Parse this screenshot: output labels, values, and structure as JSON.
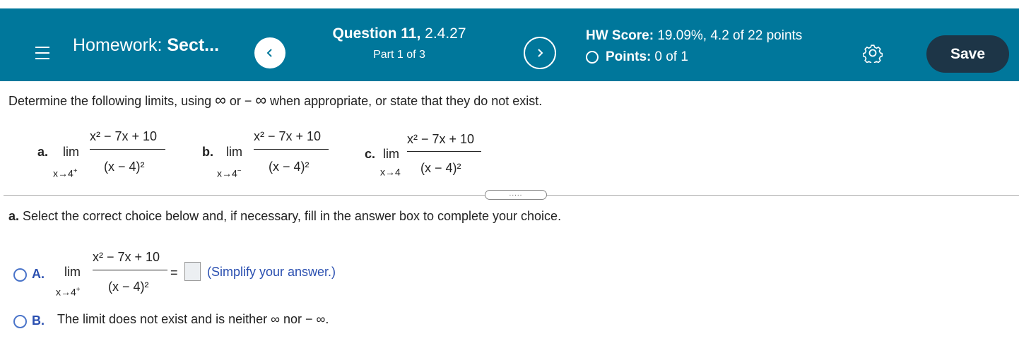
{
  "header": {
    "hw_prefix": "Homework:",
    "hw_section": "Sect...",
    "question_label": "Question 11,",
    "question_id": " 2.4.27",
    "part": "Part 1 of 3",
    "score_label": "HW Score:",
    "score_value": " 19.09%, 4.2 of 22 points",
    "points_label": "Points:",
    "points_value": "0 of 1",
    "prev_icon": "chevron-left-icon",
    "next_icon": "chevron-right-icon",
    "settings_icon": "gear-icon",
    "save_label": "Save"
  },
  "problem": {
    "instruction_pre": "Determine the following limits, using ",
    "inf_symbol": "∞",
    "instruction_mid": " or  − ",
    "instruction_post": " when appropriate, or state that they do not exist.",
    "numerator": "x² − 7x + 10",
    "denominator": "(x − 4)²",
    "lim_word": "lim",
    "parts": [
      {
        "tag": "a.",
        "approach": "x→4",
        "side": "+"
      },
      {
        "tag": "b.",
        "approach": "x→4",
        "side": "−"
      },
      {
        "tag": "c.",
        "approach": "x→4",
        "side": ""
      }
    ]
  },
  "more_label": ".....",
  "answer": {
    "prompt_tag": "a.",
    "prompt_text": " Select the correct choice below and, if necessary, fill in the answer box to complete your choice.",
    "choice_a_letter": "A.",
    "choice_a_eq": "=",
    "choice_a_hint": "(Simplify your answer.)",
    "choice_b_letter": "B.",
    "choice_b_text": "The limit does not exist and is neither ∞ nor  − ∞."
  },
  "colors": {
    "header_bg": "#00779b",
    "save_bg": "#1d3547",
    "choice_accent": "#2a4fb0"
  }
}
